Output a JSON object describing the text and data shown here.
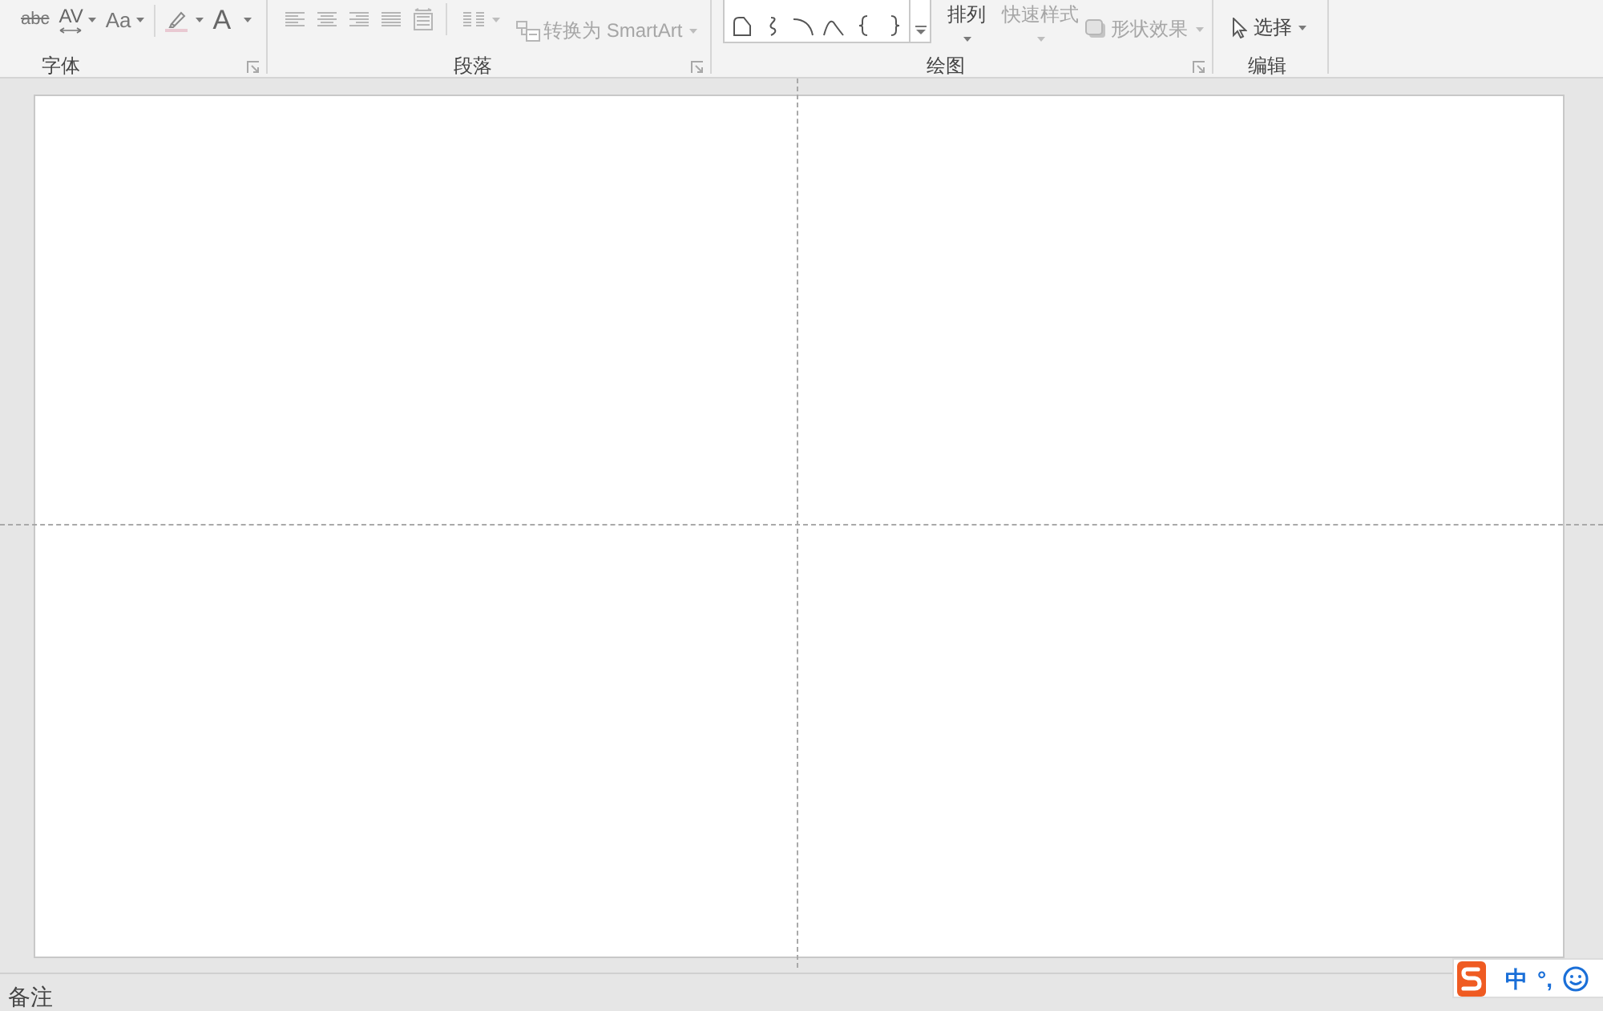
{
  "ribbon": {
    "groups": [
      {
        "kind": "font",
        "label": "字体",
        "launcher": true,
        "tools": [
          {
            "kind": "strike",
            "text": "abc",
            "dropdown": false
          },
          {
            "kind": "spacing",
            "text": "AV",
            "dropdown": true
          },
          {
            "kind": "case",
            "text": "Aa",
            "dropdown": true
          },
          {
            "kind": "highlight",
            "dropdown": true
          },
          {
            "kind": "color",
            "text": "A",
            "dropdown": true
          }
        ]
      },
      {
        "kind": "paragraph",
        "label": "段落",
        "launcher": true,
        "alignment_disabled": true,
        "columns": {
          "disabled": true
        },
        "convert": {
          "label": "转换为 SmartArt",
          "disabled": true
        }
      },
      {
        "kind": "drawing",
        "label": "绘图",
        "launcher": true,
        "buttons": [
          {
            "label": "排列",
            "disabled": false
          },
          {
            "label": "快速样式",
            "disabled": true
          }
        ],
        "effects": {
          "label": "形状效果",
          "disabled": true
        }
      },
      {
        "kind": "editing",
        "label": "编辑",
        "launcher": false,
        "select": {
          "label": "选择",
          "disabled": false
        }
      }
    ]
  },
  "slide": {
    "guides": true
  },
  "status_bar": {
    "notes": "备注"
  },
  "ime_bar": {
    "mode": "中",
    "punctuation": "°,"
  }
}
